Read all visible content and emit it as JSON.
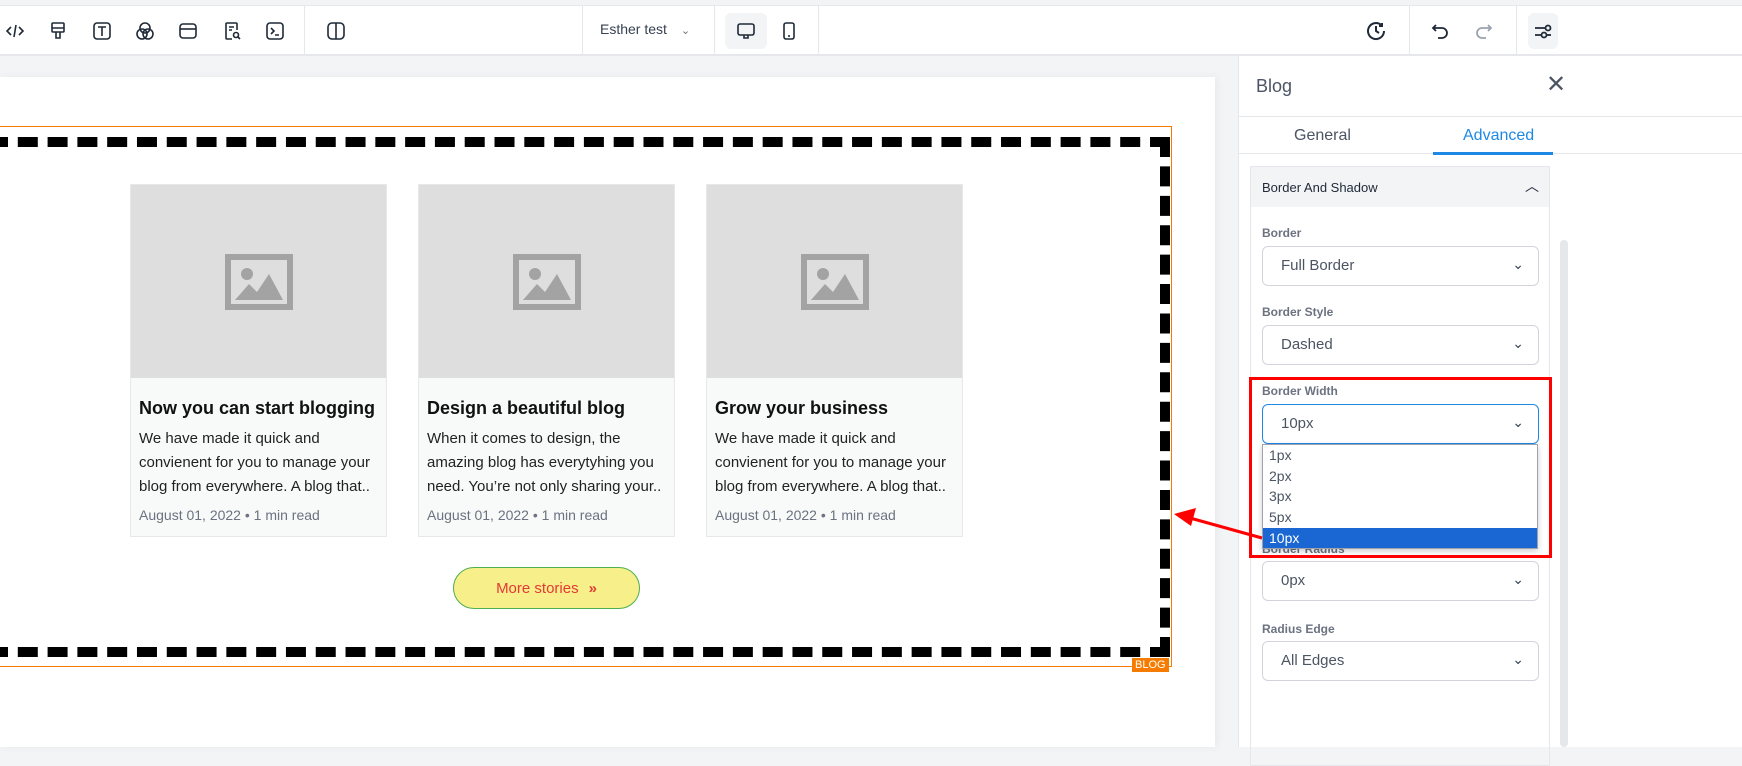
{
  "toolbar": {
    "site_name": "Esther test"
  },
  "canvas": {
    "tag": "BLOG",
    "posts": [
      {
        "title": "Now you can start blogging",
        "excerpt": "We have made it quick and convienent for you to manage your blog from everywhere. A blog that..",
        "date": "August 01, 2022",
        "read": "1 min read"
      },
      {
        "title": "Design a beautiful blog",
        "excerpt": "When it comes to design, the amazing blog has everytyhing you need. You’re not only sharing your..",
        "date": "August 01, 2022",
        "read": "1 min read"
      },
      {
        "title": "Grow your business",
        "excerpt": "We have made it quick and convienent for you to manage your blog from everywhere. A blog that..",
        "date": "August 01, 2022",
        "read": "1 min read"
      }
    ],
    "separator": "•",
    "more_label": "More stories"
  },
  "panel": {
    "title": "Blog",
    "tabs": [
      "General",
      "Advanced"
    ],
    "section": "Border And Shadow",
    "fields": {
      "border": {
        "label": "Border",
        "value": "Full Border"
      },
      "border_style": {
        "label": "Border Style",
        "value": "Dashed"
      },
      "border_width": {
        "label": "Border Width",
        "value": "10px",
        "options": [
          "1px",
          "2px",
          "3px",
          "5px",
          "10px"
        ]
      },
      "border_radius": {
        "label": "Border Radius",
        "value": "0px"
      },
      "radius_edge": {
        "label": "Radius Edge",
        "value": "All Edges"
      }
    }
  },
  "colors": {
    "accent": "#1e88e5",
    "selection": "#f57c00",
    "highlight": "#ff0000"
  }
}
